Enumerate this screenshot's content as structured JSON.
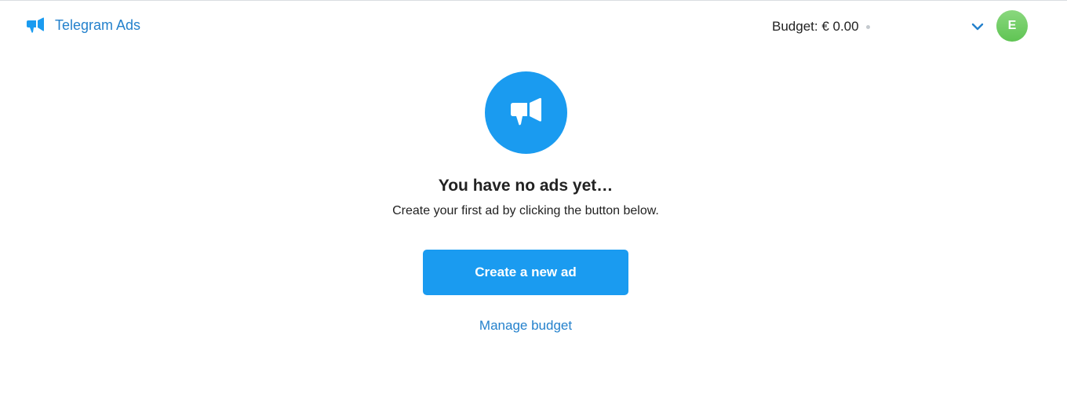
{
  "header": {
    "brand": "Telegram Ads",
    "budget_label": "Budget: € 0.00",
    "avatar_initial": "E",
    "logo_icon": "megaphone-icon",
    "menu_icon": "chevron-down-icon"
  },
  "empty_state": {
    "icon": "megaphone-icon",
    "title": "You have no ads yet…",
    "subtitle": "Create your first ad by clicking the button below.",
    "create_button_label": "Create a new ad",
    "manage_budget_link": "Manage budget"
  },
  "colors": {
    "accent": "#1a9bf0",
    "link": "#2481cc",
    "avatar": "#6ccb5f",
    "text": "#222222"
  }
}
